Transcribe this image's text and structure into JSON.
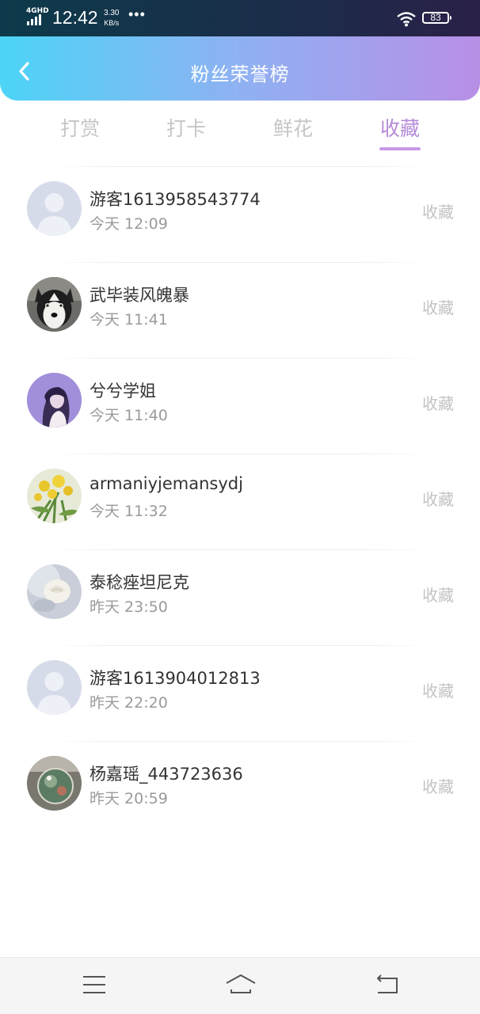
{
  "status_bar": {
    "network": "4GHD",
    "time": "12:42",
    "speed_value": "3.30",
    "speed_unit": "KB/s",
    "more": "•••",
    "battery": "83"
  },
  "header": {
    "title": "粉丝荣誉榜",
    "back_icon": "chevron-left-icon"
  },
  "tabs": [
    {
      "label": "打赏",
      "active": false
    },
    {
      "label": "打卡",
      "active": false
    },
    {
      "label": "鲜花",
      "active": false
    },
    {
      "label": "收藏",
      "active": true
    }
  ],
  "accent_color": "#b58ad8",
  "fans": [
    {
      "name": "游客1613958543774",
      "time": "今天 12:09",
      "action": "收藏",
      "avatar": "default-avatar"
    },
    {
      "name": "武毕装风魄暴",
      "time": "今天 11:41",
      "action": "收藏",
      "avatar": "husky-dog-photo"
    },
    {
      "name": "兮兮学姐",
      "time": "今天 11:40",
      "action": "收藏",
      "avatar": "girl-purple-photo"
    },
    {
      "name": "armaniyjemansydj",
      "time": "今天 11:32",
      "action": "收藏",
      "avatar": "yellow-flowers-photo"
    },
    {
      "name": "泰稔痤坦尼克",
      "time": "昨天 23:50",
      "action": "收藏",
      "avatar": "white-rose-photo"
    },
    {
      "name": "游客1613904012813",
      "time": "昨天 22:20",
      "action": "收藏",
      "avatar": "default-avatar"
    },
    {
      "name": "杨嘉瑶_443723636",
      "time": "昨天 20:59",
      "action": "收藏",
      "avatar": "crystal-ball-photo"
    }
  ],
  "nav_bar": {
    "menu_icon": "menu-icon",
    "home_icon": "home-icon",
    "back_icon": "back-icon"
  }
}
